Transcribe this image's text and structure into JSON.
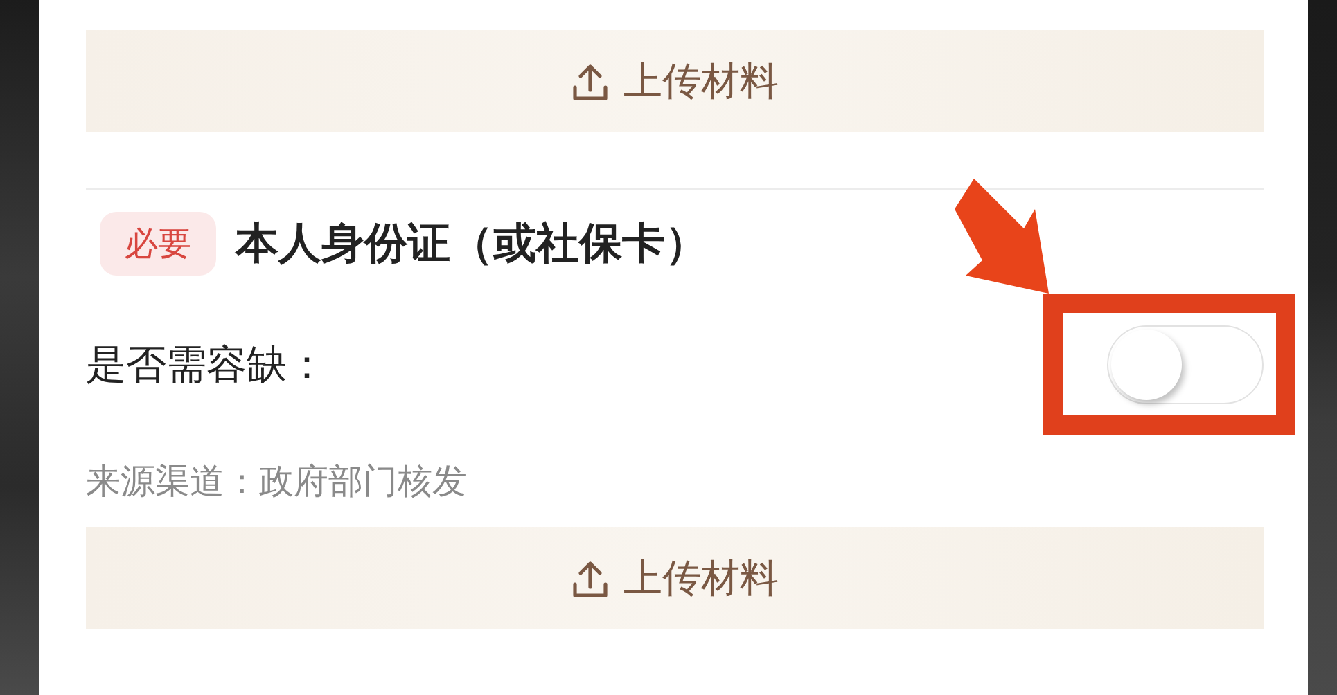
{
  "items": [
    {
      "upload_button": "上传材料"
    },
    {
      "badge": "必要",
      "title": "本人身份证（或社保卡）",
      "optional_label": "是否需容缺：",
      "optional_on": false,
      "source": "来源渠道：政府部门核发",
      "upload_button": "上传材料"
    }
  ],
  "annotation": {
    "kind": "arrow-box"
  }
}
